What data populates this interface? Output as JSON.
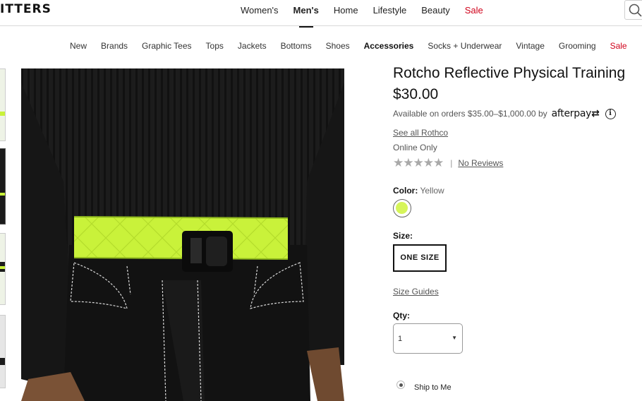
{
  "header": {
    "logo_text": "ITTERS",
    "nav": [
      "Women's",
      "Men's",
      "Home",
      "Lifestyle",
      "Beauty",
      "Sale"
    ],
    "active_nav": "Men's"
  },
  "subnav": {
    "items": [
      "New",
      "Brands",
      "Graphic Tees",
      "Tops",
      "Jackets",
      "Bottoms",
      "Shoes",
      "Accessories",
      "Socks + Underwear",
      "Vintage",
      "Grooming",
      "Sale"
    ],
    "active": "Accessories"
  },
  "product": {
    "title": "Rotcho Reflective Physical Training",
    "price": "$30.00",
    "afterpay_text": "Available on orders $35.00–$1,000.00 by",
    "afterpay_brand": "afterpay",
    "see_all": "See all Rothco",
    "availability": "Online Only",
    "rating_stars": 0,
    "rating_max": 5,
    "reviews": "No Reviews",
    "color_label": "Color:",
    "color_value": "Yellow",
    "swatch_color": "#d6f55a",
    "size_label": "Size:",
    "size_value": "ONE SIZE",
    "size_guides": "Size Guides",
    "qty_label": "Qty:",
    "qty_value": "1",
    "ship_option": "Ship to Me"
  },
  "colors": {
    "sale": "#d0021b",
    "belt": "#c9f23a",
    "shirt": "#1b1b1b"
  }
}
